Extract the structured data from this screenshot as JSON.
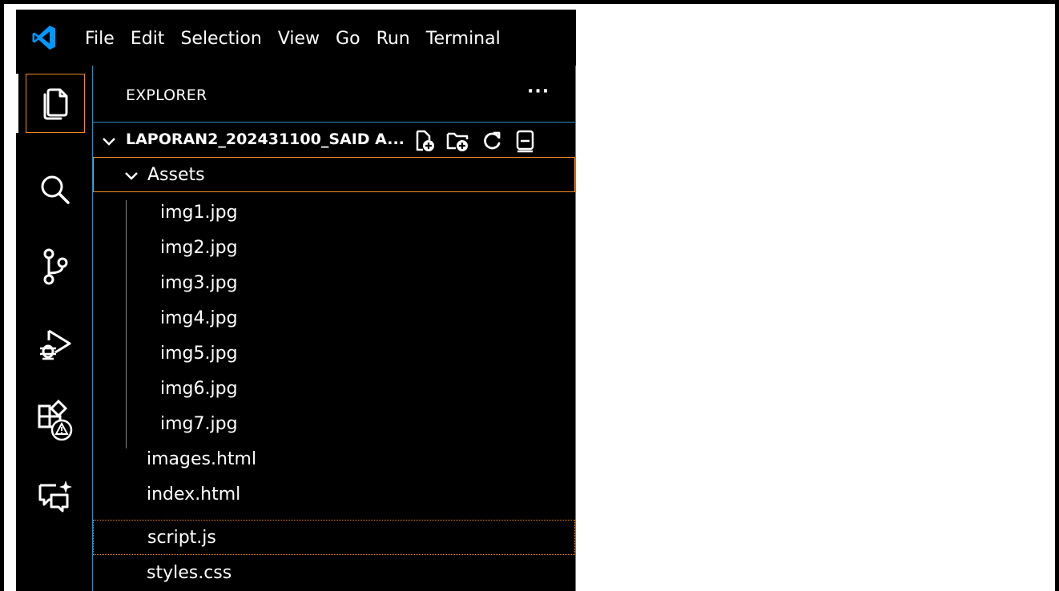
{
  "colors": {
    "background": "#000000",
    "accent_border": "#f08a24",
    "separator": "#2a8fb8",
    "vscode_blue": "#0098ff",
    "text": "#ffffff"
  },
  "menu": [
    "File",
    "Edit",
    "Selection",
    "View",
    "Go",
    "Run",
    "Terminal"
  ],
  "activity_bar": [
    {
      "icon": "explorer-files-icon",
      "active": true
    },
    {
      "icon": "search-icon",
      "active": false
    },
    {
      "icon": "source-control-icon",
      "active": false
    },
    {
      "icon": "run-debug-icon",
      "active": false
    },
    {
      "icon": "extensions-warning-icon",
      "active": false
    },
    {
      "icon": "chat-sparkle-icon",
      "active": false
    }
  ],
  "explorer": {
    "title": "EXPLORER",
    "more": "···",
    "workspace": "LAPORAN2_202431100_SAID A...",
    "actions": [
      "new-file-icon",
      "new-folder-icon",
      "refresh-icon",
      "collapse-all-icon"
    ]
  },
  "tree": {
    "folder": "Assets",
    "folder_files": [
      "img1.jpg",
      "img2.jpg",
      "img3.jpg",
      "img4.jpg",
      "img5.jpg",
      "img6.jpg",
      "img7.jpg"
    ],
    "files": [
      "images.html",
      "index.html",
      "script.js",
      "styles.css"
    ]
  }
}
